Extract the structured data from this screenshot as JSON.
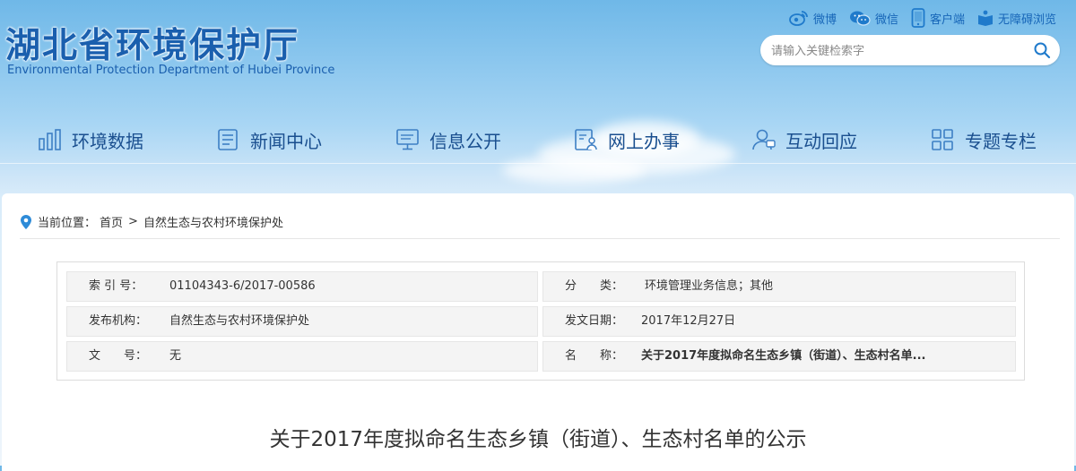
{
  "header": {
    "title_cn": "湖北省环境保护厅",
    "title_en": "Environmental Protection Department of Hubei Province",
    "brand_color": "#1a5fae"
  },
  "toplinks": [
    {
      "label": "微博",
      "icon": "weibo-icon"
    },
    {
      "label": "微信",
      "icon": "wechat-icon"
    },
    {
      "label": "客户端",
      "icon": "mobile-icon"
    },
    {
      "label": "无障碍浏览",
      "icon": "accessibility-icon"
    }
  ],
  "search": {
    "placeholder": "请输入关键检索字",
    "icon": "search-icon"
  },
  "nav": [
    {
      "label": "环境数据",
      "icon": "bar-chart-icon"
    },
    {
      "label": "新闻中心",
      "icon": "news-icon"
    },
    {
      "label": "信息公开",
      "icon": "monitor-icon"
    },
    {
      "label": "网上办事",
      "icon": "form-user-icon"
    },
    {
      "label": "互动回应",
      "icon": "user-chat-icon"
    },
    {
      "label": "专题专栏",
      "icon": "grid-icon"
    }
  ],
  "breadcrumb": {
    "label": "当前位置：",
    "items": [
      "首页",
      "自然生态与农村环境保护处"
    ],
    "separator": ">"
  },
  "meta": {
    "index_label": "索 引 号：",
    "index_value": "01104343-6/2017-00586",
    "category_label": "分　　类：",
    "category_value": "环境管理业务信息；其他",
    "publisher_label": "发布机构：",
    "publisher_value": "自然生态与农村环境保护处",
    "date_label": "发文日期：",
    "date_value": "2017年12月27日",
    "docno_label": "文　　号：",
    "docno_value": "无",
    "name_label": "名　　称：",
    "name_value": "关于2017年度拟命名生态乡镇（街道）、生态村名单..."
  },
  "document": {
    "title": "关于2017年度拟命名生态乡镇（街道）、生态村名单的公示"
  }
}
